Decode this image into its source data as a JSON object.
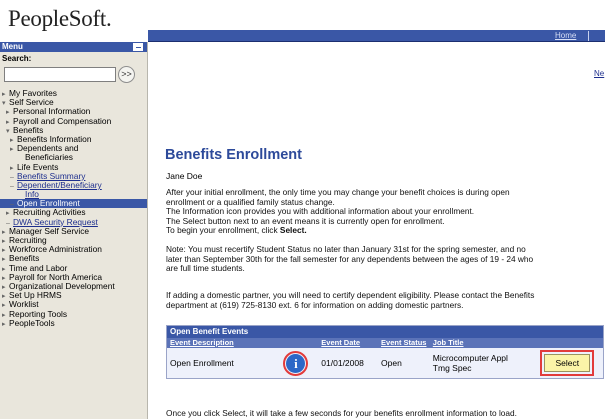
{
  "header": {
    "logo_text": "PeopleSoft.",
    "home_link": "Home"
  },
  "sidebar": {
    "menu_title": "Menu",
    "search_label": "Search:",
    "search_go_icon": ">>",
    "items": [
      {
        "label": "My Favorites",
        "level": 0,
        "arrow": "▸",
        "link": false
      },
      {
        "label": "Self Service",
        "level": 0,
        "arrow": "▾",
        "link": false
      },
      {
        "label": "Personal Information",
        "level": 1,
        "arrow": "▸",
        "link": false
      },
      {
        "label": "Payroll and Compensation",
        "level": 1,
        "arrow": "▸",
        "link": false
      },
      {
        "label": "Benefits",
        "level": 1,
        "arrow": "▾",
        "link": false
      },
      {
        "label": "Benefits Information",
        "level": 2,
        "arrow": "▸",
        "link": false
      },
      {
        "label": "Dependents and",
        "level": 2,
        "arrow": "▸",
        "link": false
      },
      {
        "label": "Beneficiaries",
        "level": 3,
        "arrow": "",
        "link": false
      },
      {
        "label": "Life Events",
        "level": 2,
        "arrow": "▸",
        "link": false
      },
      {
        "label": "Benefits Summary",
        "level": 2,
        "arrow": "–",
        "link": true
      },
      {
        "label": "Dependent/Beneficiary",
        "level": 2,
        "arrow": "–",
        "link": true
      },
      {
        "label": "Info",
        "level": 3,
        "arrow": "",
        "link": true
      },
      {
        "label": "Open Enrollment",
        "level": 2,
        "arrow": "–",
        "link": false,
        "selected": true
      },
      {
        "label": "Recruiting Activities",
        "level": 1,
        "arrow": "▸",
        "link": false
      },
      {
        "label": "DWA Security Request",
        "level": 1,
        "arrow": "–",
        "link": true
      },
      {
        "label": "Manager Self Service",
        "level": 0,
        "arrow": "▸",
        "link": false
      },
      {
        "label": "Recruiting",
        "level": 0,
        "arrow": "▸",
        "link": false
      },
      {
        "label": "Workforce Administration",
        "level": 0,
        "arrow": "▸",
        "link": false
      },
      {
        "label": "Benefits",
        "level": 0,
        "arrow": "▸",
        "link": false
      },
      {
        "label": "Time and Labor",
        "level": 0,
        "arrow": "▸",
        "link": false
      },
      {
        "label": "Payroll for North America",
        "level": 0,
        "arrow": "▸",
        "link": false
      },
      {
        "label": "Organizational Development",
        "level": 0,
        "arrow": "▸",
        "link": false
      },
      {
        "label": "Set Up HRMS",
        "level": 0,
        "arrow": "▸",
        "link": false
      },
      {
        "label": "Worklist",
        "level": 0,
        "arrow": "▸",
        "link": false
      },
      {
        "label": "Reporting Tools",
        "level": 0,
        "arrow": "▸",
        "link": false
      },
      {
        "label": "PeopleTools",
        "level": 0,
        "arrow": "▸",
        "link": false
      }
    ]
  },
  "main": {
    "top_link": "Ne",
    "title": "Benefits Enrollment",
    "employee_name": "Jane Doe",
    "para1_lines": [
      "After your initial enrollment, the only time you may change your benefit choices is during open",
      "enrollment or a qualified family status change.",
      "The Information icon provides you with additional information about your enrollment.",
      "The Select button next to an event means it is currently open for enrollment."
    ],
    "para1_last_prefix": "To begin your enrollment, click ",
    "para1_last_bold": "Select.",
    "para2_lines": [
      "Note: You must recertify Student Status no later than January 31st for the spring semester, and no",
      "later than September 30th for the fall semester for any dependents between the ages of 19 - 24 who",
      "are full time students."
    ],
    "para3_lines": [
      "If adding a domestic partner, you will need to certify dependent eligibility. Please contact the Benefits",
      "department at (619) 725-8130 ext. 6 for information on adding domestic partners."
    ],
    "table": {
      "caption": "Open Benefit Events",
      "headers": [
        "Event Description",
        "",
        "Event Date",
        "Event Status",
        "Job Title",
        ""
      ],
      "row": {
        "description": "Open Enrollment",
        "info_icon": "i",
        "date": "01/01/2008",
        "status": "Open",
        "job_title_line1": "Microcomputer Appl",
        "job_title_line2": "Tmg Spec",
        "select_label": "Select"
      }
    },
    "footer": "Once you click Select, it will take a few seconds for your benefits enrollment information to load."
  }
}
